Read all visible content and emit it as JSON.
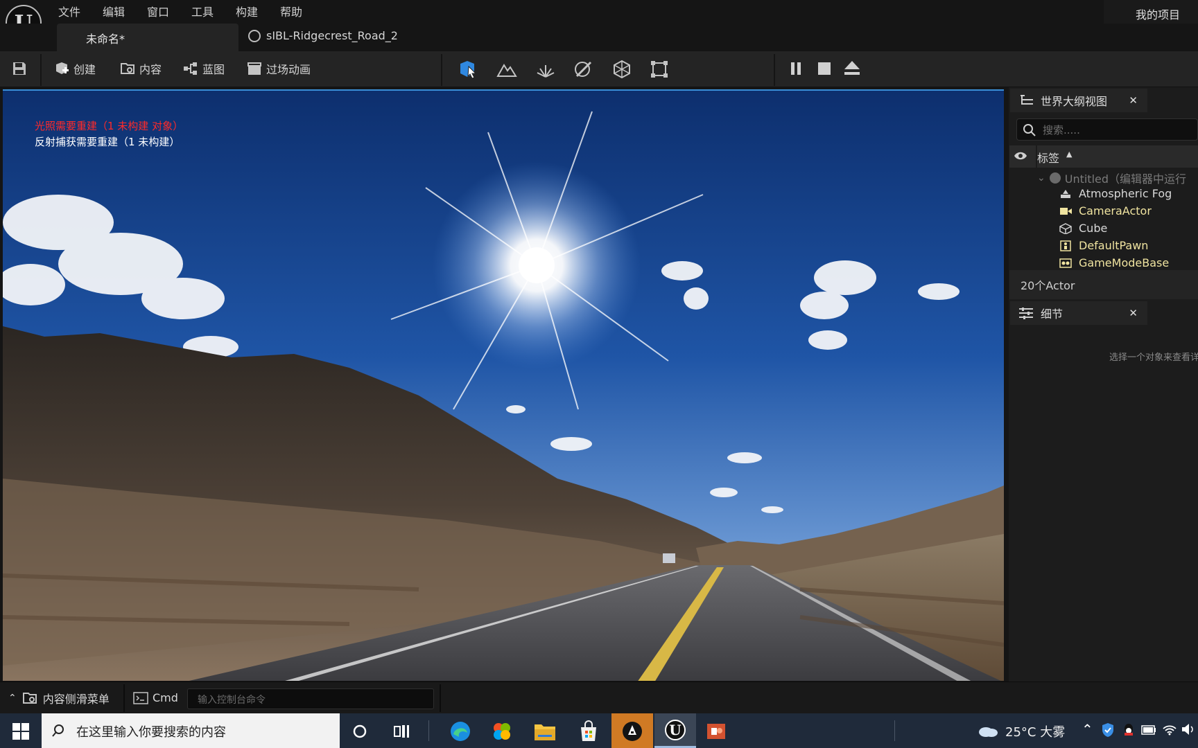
{
  "menubar": {
    "logo": "U",
    "items": [
      "文件",
      "编辑",
      "窗口",
      "工具",
      "构建",
      "帮助"
    ],
    "project": "我的项目"
  },
  "tabs": {
    "active": "未命名*",
    "second": "sIBL-Ridgecrest_Road_2"
  },
  "toolbar": {
    "create": "创建",
    "content": "内容",
    "blueprint": "蓝图",
    "cinematics": "过场动画"
  },
  "viewport": {
    "msg_lighting": "光照需要重建（1 未构建 对象）",
    "msg_reflection": "反射捕获需要重建（1 未构建）"
  },
  "outliner": {
    "title": "世界大纲视图",
    "search_placeholder": "搜索.....",
    "col_label": "标签",
    "root": "Untitled（编辑器中运行",
    "items": [
      "Atmospheric Fog",
      "CameraActor",
      "Cube",
      "DefaultPawn",
      "GameModeBase"
    ],
    "count": "20个Actor"
  },
  "details": {
    "title": "细节",
    "hint": "选择一个对象来查看详"
  },
  "statusbar": {
    "content_drawer": "内容侧滑菜单",
    "cmd": "Cmd",
    "console_placeholder": "输入控制台命令"
  },
  "taskbar": {
    "search_placeholder": "在这里输入你要搜索的内容",
    "weather": "25°C 大雾"
  },
  "colors": {
    "accent_blue": "#3a8fd8",
    "warning_red": "#ff2a2a",
    "highlight_yellow": "#f0e4a0"
  }
}
